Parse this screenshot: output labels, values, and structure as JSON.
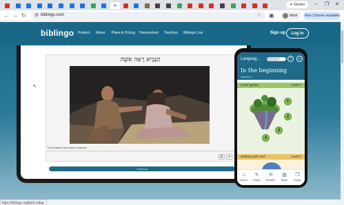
{
  "browser": {
    "tabs": [
      {
        "color": "#d93025",
        "letter": "M"
      },
      {
        "color": "#1a73e8",
        "letter": ""
      },
      {
        "color": "#1a73e8",
        "letter": ""
      },
      {
        "color": "#1a73e8",
        "letter": ""
      },
      {
        "color": "#1a73e8",
        "letter": ""
      },
      {
        "color": "#1a73e8",
        "letter": ""
      },
      {
        "color": "#1a73e8",
        "letter": ""
      },
      {
        "color": "#1a73e8",
        "letter": ""
      },
      {
        "color": "#34a853",
        "letter": "G"
      },
      {
        "color": "#1a73e8",
        "letter": ""
      },
      {
        "color": "#ffffff",
        "letter": "",
        "active": true
      },
      {
        "color": "#d93025",
        "letter": ""
      },
      {
        "color": "#1a73e8",
        "letter": ""
      },
      {
        "color": "#8a6d3b",
        "letter": ""
      },
      {
        "color": "#444444",
        "letter": ""
      },
      {
        "color": "#444444",
        "letter": ""
      },
      {
        "color": "#34a853",
        "letter": "G"
      },
      {
        "color": "#d93025",
        "letter": ""
      },
      {
        "color": "#d93025",
        "letter": ""
      },
      {
        "color": "#d93025",
        "letter": ""
      },
      {
        "color": "#444444",
        "letter": ""
      },
      {
        "color": "#34a853",
        "letter": "G"
      },
      {
        "color": "#d93025",
        "letter": ""
      },
      {
        "color": "#d93025",
        "letter": ""
      },
      {
        "color": "#d93025",
        "letter": ""
      }
    ],
    "gemini_label": "Gemini",
    "url": "biblingo.com",
    "profile_label": "Work",
    "new_chrome_label": "New Chrome available",
    "status_url": "https://biblingo.org/back-today-lo"
  },
  "site": {
    "logo": "biblingo",
    "nav": [
      "Product",
      "About",
      "Plans & Pricing",
      "Homeschool",
      "Teachers",
      "Biblingo Live"
    ],
    "signup": "Sign up",
    "login": "Log In"
  },
  "lesson": {
    "hebrew": "הַנָּבִיא רָאָה אִשָּׁה",
    "caption": "The prophet has heard a woman.",
    "continue": "Continue"
  },
  "phone": {
    "language_label": "Languag...",
    "title": "In the beginning",
    "subtitle": "Journey 1",
    "unit1": {
      "label": "In the garden",
      "level": "Level 1"
    },
    "unit2": {
      "label": "Walking with God",
      "level": "Level 2"
    },
    "nodes": [
      "1",
      "2",
      "3",
      "4"
    ],
    "nav": [
      {
        "label": "Home",
        "icon": "home-icon"
      },
      {
        "label": "Learn",
        "icon": "learn-icon"
      },
      {
        "label": "Review",
        "icon": "review-icon"
      },
      {
        "label": "Bank",
        "icon": "bank-icon"
      },
      {
        "label": "Read",
        "icon": "read-icon"
      }
    ]
  },
  "colors": {
    "brand": "#1a6888",
    "unit1": "#9cc66a",
    "unit2": "#e9c267"
  }
}
